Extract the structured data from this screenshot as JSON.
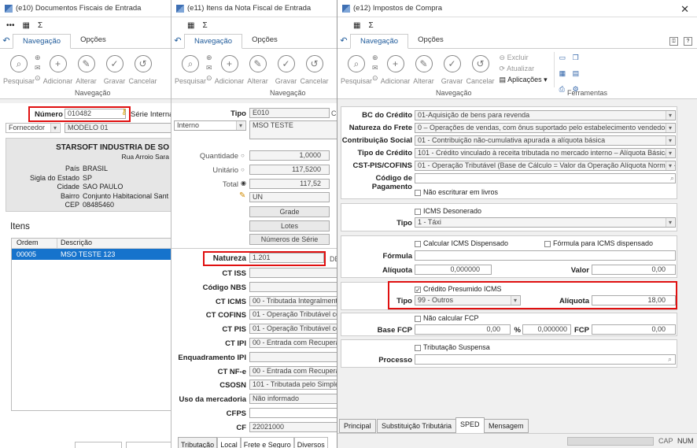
{
  "w1": {
    "title": "(e10) Documentos Fiscais de Entrada",
    "qat": "•••",
    "tabs": [
      "Navegação",
      "Opções"
    ],
    "ribbon": [
      "Pesquisar",
      "Adicionar",
      "Alterar",
      "Gravar",
      "Cancelar"
    ],
    "group": "Navegação",
    "numero_label": "Número",
    "numero_value": "010482",
    "serie_label": "Série Interna",
    "fornecedor_label": "Fornecedor",
    "fornecedor_value": "MODELO 01",
    "company": "STARSOFT INDUSTRIA DE SO",
    "street": "Rua Arroio Sara",
    "address": [
      {
        "label": "País",
        "value": "BRASIL"
      },
      {
        "label": "Sigla do Estado",
        "value": "SP"
      },
      {
        "label": "Cidade",
        "value": "SAO PAULO"
      },
      {
        "label": "Bairro",
        "value": "Conjunto Habitacional Sant"
      },
      {
        "label": "CEP",
        "value": "08485460"
      }
    ],
    "itens_label": "Itens",
    "col_ordem": "Ordem",
    "col_desc": "Descrição",
    "row_ordem": "00005",
    "row_desc": "MSO TESTE 123"
  },
  "w2": {
    "title": "(e11) Itens da Nota Fiscal de Entrada",
    "tabs": [
      "Navegação",
      "Opções"
    ],
    "ribbon": [
      "Pesquisar",
      "Adicionar",
      "Alterar",
      "Gravar",
      "Cancelar"
    ],
    "group": "Navegação",
    "tipo_label": "Tipo",
    "tipo_value": "E010",
    "tipo_code": "CO",
    "interno": "Interno",
    "interno_desc": "MSO TESTE",
    "qtd_label": "Quantidade",
    "qtd_value": "1,0000",
    "unit_label": "Unitário",
    "unit_value": "117,5200",
    "total_label": "Total",
    "total_value": "117,52",
    "un_value": "UN",
    "btn_grade": "Grade",
    "btn_lotes": "Lotes",
    "btn_series": "Números de Série",
    "natureza_label": "Natureza",
    "natureza_value": "1.201",
    "natureza_extra": "DE",
    "fields": [
      {
        "label": "CT ISS",
        "value": ""
      },
      {
        "label": "Código NBS",
        "value": ""
      },
      {
        "label": "CT ICMS",
        "value": "00 - Tributada Integralmente"
      },
      {
        "label": "CT COFINS",
        "value": "01 - Operação Tributável cor"
      },
      {
        "label": "CT PIS",
        "value": "01 - Operação Tributável cor"
      },
      {
        "label": "CT IPI",
        "value": "00 - Entrada com Recupera"
      },
      {
        "label": "Enquadramento IPI",
        "value": ""
      },
      {
        "label": "CT NF-e",
        "value": "00 - Entrada com Recupera"
      },
      {
        "label": "CSOSN",
        "value": "101 - Tributada pelo Simples"
      },
      {
        "label": "Uso da mercadoria",
        "value": "Não informado"
      },
      {
        "label": "CFPS",
        "value": ""
      },
      {
        "label": "CF",
        "value": "22021000"
      }
    ],
    "bottom_tabs": [
      "Tributação",
      "Local",
      "Frete e Seguro",
      "Diversos"
    ]
  },
  "w3": {
    "title": "(e12) Impostos de Compra",
    "tabs": [
      "Navegação",
      "Opções"
    ],
    "ribbon": [
      "Pesquisar",
      "Adicionar",
      "Alterar",
      "Gravar",
      "Cancelar"
    ],
    "small": [
      "Excluir",
      "Atualizar",
      "Aplicações"
    ],
    "group_nav": "Navegação",
    "group_tools": "Ferramentas",
    "top_fields": [
      {
        "label": "BC do Crédito",
        "value": "01-Aquisição de bens para revenda"
      },
      {
        "label": "Natureza do Frete",
        "value": "0 – Operações de vendas, com ônus suportado pelo estabelecimento vendedor"
      },
      {
        "label": "Contribuição Social",
        "value": "01 - Contribuição não-cumulativa apurada a alíquota básica"
      },
      {
        "label": "Tipo de Crédito",
        "value": "101 - Crédito vinculado à receita tributada no mercado interno – Alíquota Básica"
      },
      {
        "label": "CST-PIS/COFINS",
        "value": "01 - Operação Tributável (Base de Cálculo = Valor da Operação Alíquota Normal -"
      },
      {
        "label": "Código de Pagamento",
        "value": ""
      }
    ],
    "nao_escriturar": "Não escriturar em livros",
    "icms_desonerado": "ICMS Desonerado",
    "tipo_label": "Tipo",
    "tipo_value": "1 - Táxi",
    "calc_icms": "Calcular ICMS Dispensado",
    "formula_icms": "Fórmula para ICMS dispensado",
    "formula_label": "Fórmula",
    "aliquota_label": "Alíquota",
    "aliquota_value": "0,000000",
    "valor_label": "Valor",
    "valor_value": "0,00",
    "credito_presumido": "Crédito Presumido ICMS",
    "cp_tipo_value": "99 - Outros",
    "cp_aliq_label": "Alíquota",
    "cp_aliq_value": "18,00",
    "nao_calc_fcp": "Não calcular FCP",
    "base_fcp_label": "Base FCP",
    "base_fcp_value": "0,00",
    "pct": "%",
    "pct_value": "0,000000",
    "fcp_label": "FCP",
    "fcp_value": "0,00",
    "trib_suspensa": "Tributação Suspensa",
    "processo_label": "Processo",
    "bottom_tabs": [
      "Principal",
      "Substituição Tributária",
      "SPED",
      "Mensagem"
    ]
  },
  "status": {
    "cap": "CAP",
    "num": "NUM"
  }
}
